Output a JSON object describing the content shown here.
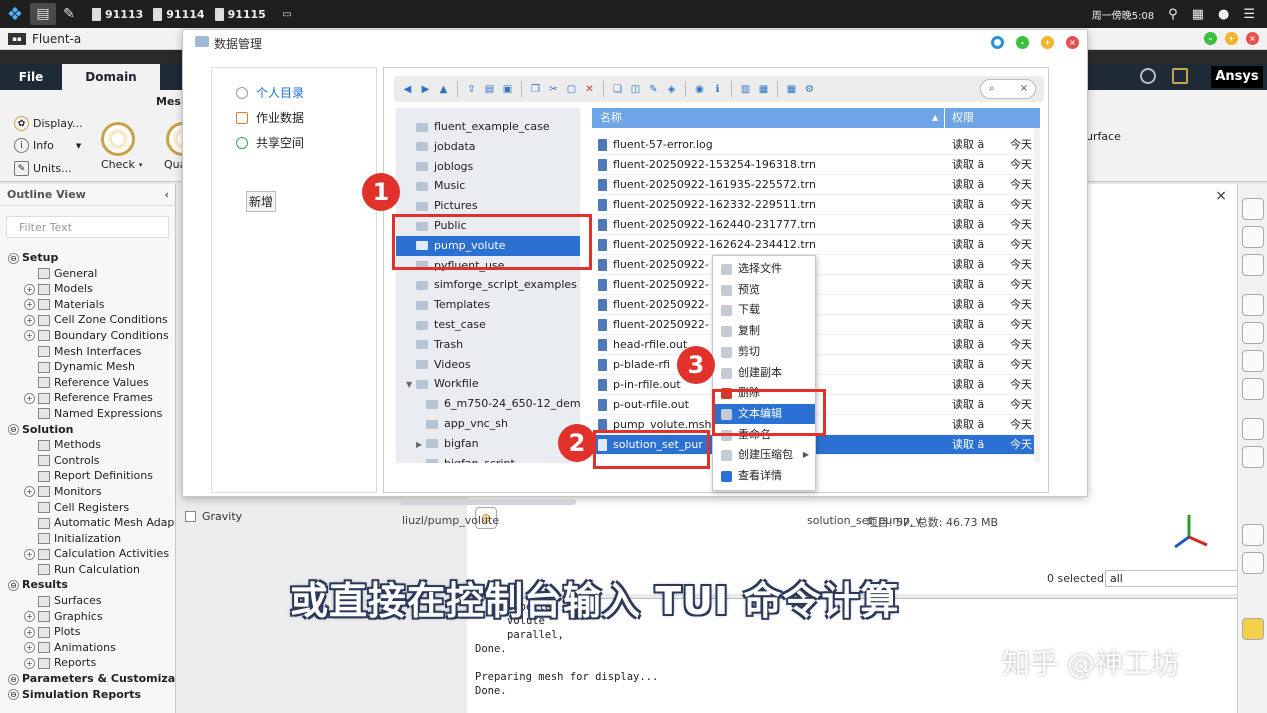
{
  "taskbar": {
    "tasks": [
      "91113",
      "91114",
      "91115"
    ],
    "clock": "周一傍晚5:08"
  },
  "fluent": {
    "title": "Fluent-a",
    "tabs": {
      "file": "File",
      "domain": "Domain"
    },
    "brand": "Ansys",
    "ribbon": {
      "group": "Mesh",
      "display": "Display...",
      "info": "Info",
      "units": "Units...",
      "check": "Check",
      "quality": "Qua",
      "surface": "urface"
    }
  },
  "outline": {
    "title": "Outline View",
    "filter_placeholder": "Filter Text",
    "items": [
      {
        "label": "Setup",
        "section": true
      },
      {
        "label": "General"
      },
      {
        "label": "Models"
      },
      {
        "label": "Materials"
      },
      {
        "label": "Cell Zone Conditions"
      },
      {
        "label": "Boundary Conditions"
      },
      {
        "label": "Mesh Interfaces"
      },
      {
        "label": "Dynamic Mesh"
      },
      {
        "label": "Reference Values"
      },
      {
        "label": "Reference Frames"
      },
      {
        "label": "Named Expressions"
      },
      {
        "label": "Solution",
        "section": true
      },
      {
        "label": "Methods"
      },
      {
        "label": "Controls"
      },
      {
        "label": "Report Definitions"
      },
      {
        "label": "Monitors"
      },
      {
        "label": "Cell Registers"
      },
      {
        "label": "Automatic Mesh Adap"
      },
      {
        "label": "Initialization"
      },
      {
        "label": "Calculation Activities"
      },
      {
        "label": "Run Calculation"
      },
      {
        "label": "Results",
        "section": true
      },
      {
        "label": "Surfaces"
      },
      {
        "label": "Graphics"
      },
      {
        "label": "Plots"
      },
      {
        "label": "Animations"
      },
      {
        "label": "Reports"
      },
      {
        "label": "Parameters & Customiza",
        "section": true
      },
      {
        "label": "Simulation Reports",
        "section": true
      }
    ]
  },
  "center": {
    "gravity": "Gravity",
    "selected": "0 selected",
    "select_value": "all",
    "console": [
      "impeller",
      "volute",
      "parallel,",
      "Done.",
      "",
      "Preparing mesh for display...",
      "Done."
    ]
  },
  "dialog": {
    "title": "数据管理",
    "nav": {
      "home": "个人目录",
      "jobs": "作业数据",
      "shared": "共享空间",
      "new": "新增"
    },
    "search_placeholder": "",
    "folders": [
      "fluent_example_case",
      "jobdata",
      "joblogs",
      "Music",
      "Pictures",
      "Public",
      "pump_volute",
      "pyfluent_use",
      "simforge_script_examples",
      "Templates",
      "test_case",
      "Trash",
      "Videos",
      "Workfile",
      "6_m750-24_650-12_dem",
      "app_vnc_sh",
      "bigfan",
      "bigfan_script"
    ],
    "columns": {
      "name": "名称",
      "perm": "权限",
      "date": ""
    },
    "files": [
      {
        "name": "fluent-57-error.log",
        "perm": "读取 ä",
        "date": "今天"
      },
      {
        "name": "fluent-20250922-153254-196318.trn",
        "perm": "读取 ä",
        "date": "今天"
      },
      {
        "name": "fluent-20250922-161935-225572.trn",
        "perm": "读取 ä",
        "date": "今天"
      },
      {
        "name": "fluent-20250922-162332-229511.trn",
        "perm": "读取 ä",
        "date": "今天"
      },
      {
        "name": "fluent-20250922-162440-231777.trn",
        "perm": "读取 ä",
        "date": "今天"
      },
      {
        "name": "fluent-20250922-162624-234412.trn",
        "perm": "读取 ä",
        "date": "今天"
      },
      {
        "name": "fluent-20250922-",
        "perm": "读取 ä",
        "date": "今天"
      },
      {
        "name": "fluent-20250922-",
        "perm": "读取 ä",
        "date": "今天"
      },
      {
        "name": "fluent-20250922-",
        "perm": "读取 ä",
        "date": "今天"
      },
      {
        "name": "fluent-20250922-",
        "perm": "读取 ä",
        "date": "今天"
      },
      {
        "name": "head-rfile.out",
        "perm": "读取 ä",
        "date": "今天"
      },
      {
        "name": "p-blade-rfi",
        "perm": "读取 ä",
        "date": "今天"
      },
      {
        "name": "p-in-rfile.out",
        "perm": "读取 ä",
        "date": "今天"
      },
      {
        "name": "p-out-rfile.out",
        "perm": "读取 ä",
        "date": "今天"
      },
      {
        "name": "pump_volute.msh",
        "perm": "读取 ä",
        "date": "今天"
      },
      {
        "name": "solution_set_pur",
        "perm": "读取 ä",
        "date": "今天"
      }
    ],
    "status_path": "liuzl/pump_volute",
    "status_selected": "solution_set_pump_v",
    "status_count": "项目: 57, 总数: 46.73 MB"
  },
  "context_menu": {
    "items": [
      "选择文件",
      "预览",
      "下载",
      "复制",
      "剪切",
      "创建副本",
      "删除",
      "文本编辑",
      "重命名",
      "创建压缩包",
      "查看详情"
    ],
    "selected_index": 7
  },
  "annotations": {
    "badges": [
      "1",
      "2",
      "3"
    ],
    "subtitle": "或直接在控制台输入 TUI 命令计算",
    "watermark": "知乎 @神工坊"
  },
  "colors": {
    "accent": "#2b70d3",
    "highlight": "#e0312b",
    "ribbon_dark": "#1f2a37"
  }
}
